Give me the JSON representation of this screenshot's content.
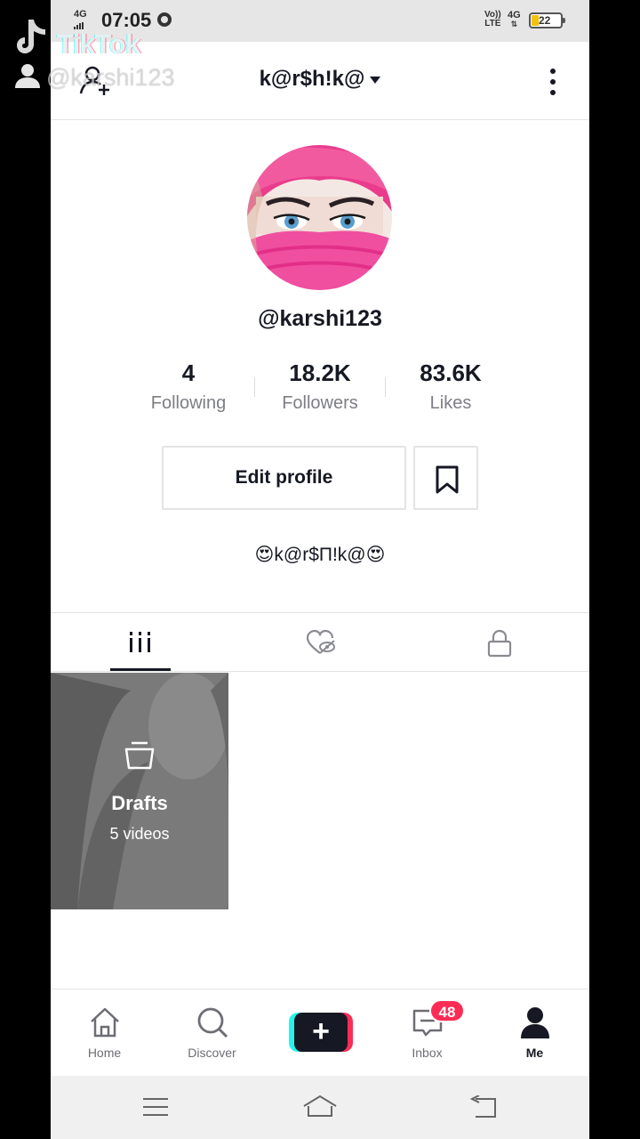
{
  "status_bar": {
    "network_left": "4G",
    "time": "07:05",
    "network_right_top": "Vo))",
    "network_right_bottom": "LTE",
    "network_right2_top": "4G",
    "network_right2_bottom": "⇅",
    "battery_level": "22"
  },
  "header": {
    "username_title": "k@r$h!k@"
  },
  "profile": {
    "handle": "@karshi123",
    "stats": [
      {
        "value": "4",
        "label": "Following"
      },
      {
        "value": "18.2K",
        "label": "Followers"
      },
      {
        "value": "83.6K",
        "label": "Likes"
      }
    ],
    "edit_profile_label": "Edit profile",
    "bio": "😍k@r$П!k@😍"
  },
  "tabs": [
    "videos-grid",
    "liked-hidden",
    "private"
  ],
  "drafts": {
    "title": "Drafts",
    "count": "5 videos"
  },
  "bottom_nav": {
    "items": [
      {
        "label": "Home"
      },
      {
        "label": "Discover"
      },
      {
        "label": "+"
      },
      {
        "label": "Inbox",
        "badge": "48"
      },
      {
        "label": "Me"
      }
    ]
  },
  "watermark": {
    "brand": "TikTok",
    "user": "@karshi123"
  },
  "colors": {
    "accent_red": "#fe2c55",
    "accent_cyan": "#25f4ee",
    "text_primary": "#161823",
    "text_secondary": "#7d7e84"
  }
}
